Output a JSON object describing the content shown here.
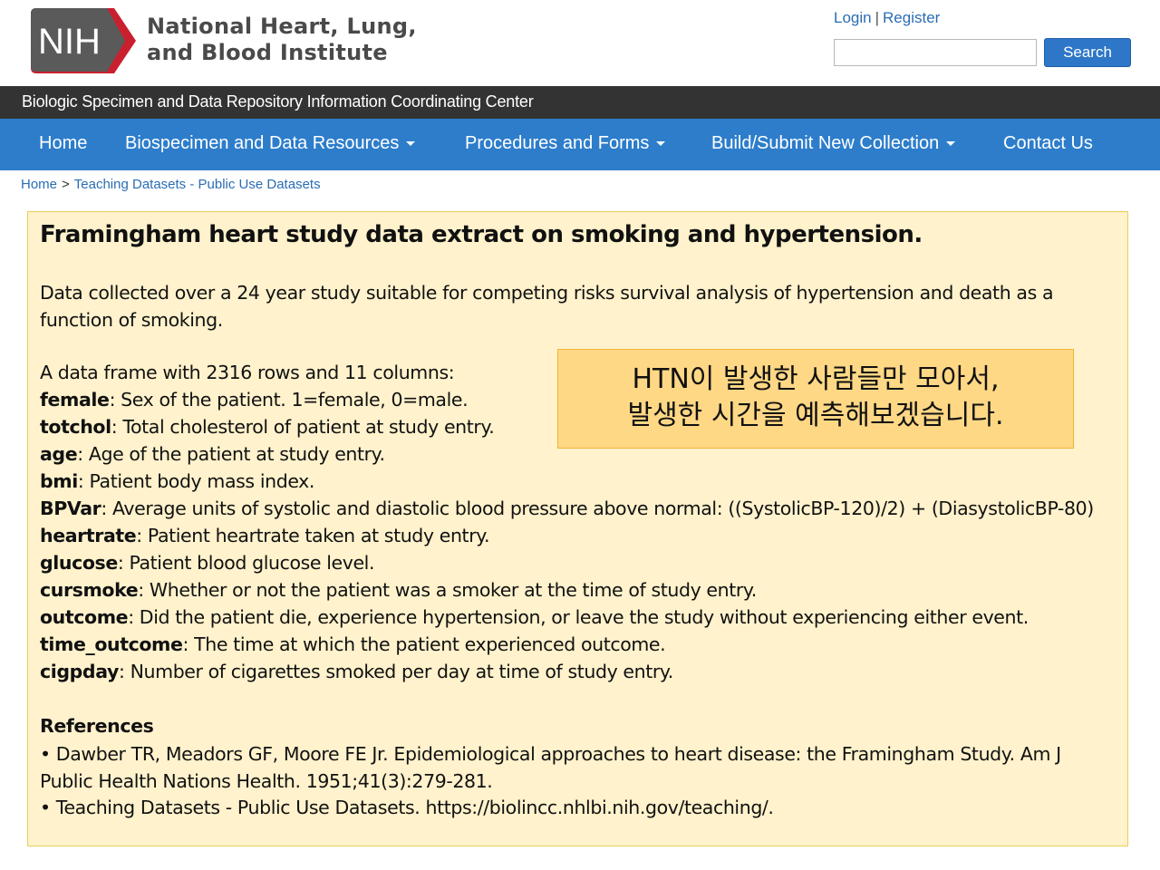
{
  "header": {
    "logo_text": "NIH",
    "institute_line1": "National Heart, Lung,",
    "institute_line2": "and Blood Institute",
    "login_label": "Login",
    "separator": "|",
    "register_label": "Register",
    "search_value": "",
    "search_button": "Search"
  },
  "title_bar": {
    "text": "Biologic Specimen and Data Repository Information Coordinating Center"
  },
  "nav": {
    "items": [
      {
        "label": "Home",
        "dropdown": false
      },
      {
        "label": "Biospecimen and Data Resources",
        "dropdown": true
      },
      {
        "label": "Procedures and Forms",
        "dropdown": true
      },
      {
        "label": "Build/Submit New Collection",
        "dropdown": true
      },
      {
        "label": "Contact Us",
        "dropdown": false
      }
    ]
  },
  "breadcrumb": {
    "home": "Home",
    "separator": ">",
    "current": "Teaching Datasets - Public Use Datasets"
  },
  "content": {
    "title": "Framingham heart study data extract on smoking and hypertension.",
    "description": "Data collected over a 24 year study suitable for competing risks survival analysis of hypertension and death as a function of smoking.",
    "frame_intro": "A data frame with 2316 rows and 11 columns:",
    "variables": [
      {
        "name": "female",
        "desc": ": Sex of the patient. 1=female, 0=male."
      },
      {
        "name": "totchol",
        "desc": ": Total cholesterol of patient at study entry."
      },
      {
        "name": "age",
        "desc": ": Age of the patient at study entry."
      },
      {
        "name": "bmi",
        "desc": ": Patient body mass index."
      },
      {
        "name": "BPVar",
        "desc": ": Average units of systolic and diastolic blood pressure above normal: ((SystolicBP-120)/2) + (DiasystolicBP-80)"
      },
      {
        "name": "heartrate",
        "desc": ": Patient heartrate taken at study entry."
      },
      {
        "name": "glucose",
        "desc": ": Patient blood glucose level."
      },
      {
        "name": "cursmoke",
        "desc": ": Whether or not the patient was a smoker at the time of study entry."
      },
      {
        "name": "outcome",
        "desc": ": Did the patient die, experience hypertension, or leave the study without experiencing either event."
      },
      {
        "name": "time_outcome",
        "desc": ": The time at which the patient experienced outcome."
      },
      {
        "name": "cigpday",
        "desc": ": Number of cigarettes smoked per day at time of study entry."
      }
    ],
    "references_heading": "References",
    "reference_1": "• Dawber TR, Meadors GF, Moore FE Jr. Epidemiological approaches to heart disease: the Framingham Study. Am J Public Health Nations Health. 1951;41(3):279-281.",
    "reference_2": "• Teaching Datasets - Public Use Datasets. https://biolincc.nhlbi.nih.gov/teaching/."
  },
  "callout": {
    "line1": "HTN이 발생한 사람들만 모아서,",
    "line2": "발생한 시간을 예측해보겠습니다."
  },
  "colors": {
    "nav_bg": "#2d7dcb",
    "title_bar_bg": "#333333",
    "link": "#2a6db3",
    "panel_bg": "#fff2cc",
    "callout_bg": "#ffd885",
    "nih_red": "#c8202f",
    "nih_gray": "#5a5a5a"
  }
}
